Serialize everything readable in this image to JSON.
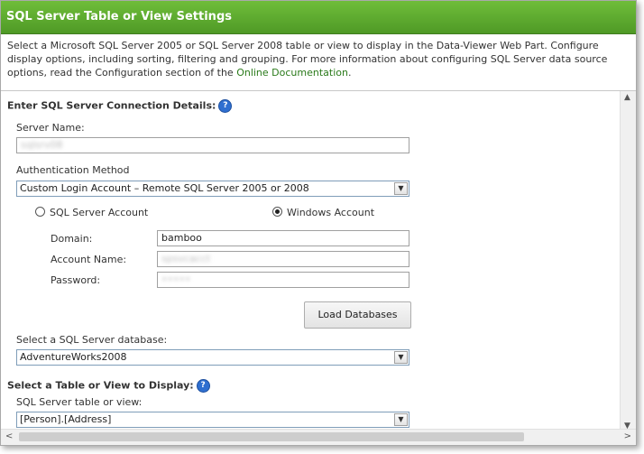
{
  "panel": {
    "title": "SQL Server Table or View Settings",
    "description_before_link": "Select a Microsoft SQL Server 2005 or SQL Server 2008 table or view to display in the Data-Viewer Web Part. Configure display options, including sorting, filtering and grouping. For more information about configuring SQL Server data source options, read the Configuration section of the ",
    "description_link": "Online Documentation",
    "description_after_link": "."
  },
  "connection": {
    "heading": "Enter SQL Server Connection Details:",
    "server_name_label": "Server Name:",
    "server_name_value": "sqlsrv08",
    "auth_label": "Authentication Method",
    "auth_selected": "Custom Login Account – Remote SQL Server 2005 or 2008",
    "radio_sql_label": "SQL Server Account",
    "radio_windows_label": "Windows Account",
    "selected_account_type": "Windows Account",
    "domain_label": "Domain:",
    "domain_value": "bamboo",
    "account_name_label": "Account Name:",
    "account_name_value": "spsvcacct",
    "password_label": "Password:",
    "password_value": "•••••",
    "load_button": "Load Databases",
    "database_label": "Select a SQL Server database:",
    "database_selected": "AdventureWorks2008"
  },
  "table_view": {
    "heading": "Select a Table or View to Display:",
    "label": "SQL Server table or view:",
    "selected": "[Person].[Address]"
  },
  "colors": {
    "header_green": "#4f9a26",
    "link_green": "#2a7a1a",
    "help_blue": "#2f6fd0"
  }
}
